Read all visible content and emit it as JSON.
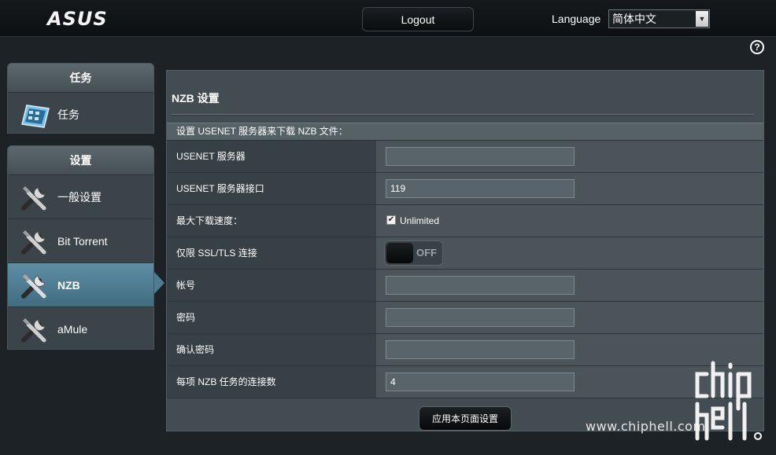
{
  "header": {
    "logo": "ASUS",
    "logout_label": "Logout",
    "language_label": "Language",
    "language_value": "简体中文"
  },
  "sidebar": {
    "task_section": {
      "title": "任务",
      "items": [
        {
          "label": "任务",
          "icon": "task-manager-icon"
        }
      ]
    },
    "settings_section": {
      "title": "设置",
      "items": [
        {
          "label": "一般设置",
          "icon": "tools-icon"
        },
        {
          "label": "Bit Torrent",
          "icon": "tools-icon"
        },
        {
          "label": "NZB",
          "icon": "tools-icon",
          "active": true
        },
        {
          "label": "aMule",
          "icon": "tools-icon"
        }
      ]
    }
  },
  "main": {
    "title": "NZB 设置",
    "section_heading": "设置 USENET 服务器来下载 NZB 文件：",
    "rows": [
      {
        "label": "USENET 服务器",
        "value": ""
      },
      {
        "label": "USENET 服务器接口",
        "value": "119"
      },
      {
        "label": "最大下载速度：",
        "checkbox_label": "Unlimited",
        "checked": true
      },
      {
        "label": "仅限 SSL/TLS 连接",
        "toggle_label": "OFF"
      },
      {
        "label": "帐号",
        "value": ""
      },
      {
        "label": "密码",
        "value": ""
      },
      {
        "label": "确认密码",
        "value": ""
      },
      {
        "label": "每项 NZB 任务的连接数",
        "value": "4"
      }
    ],
    "apply_label": "应用本页面设置"
  },
  "watermark": {
    "url": "www.chiphell.com",
    "logo_text": "chip hell"
  },
  "colors": {
    "active_item": "#4f7f94",
    "panel_bg": "#434c51",
    "page_bg": "#1c2226"
  }
}
